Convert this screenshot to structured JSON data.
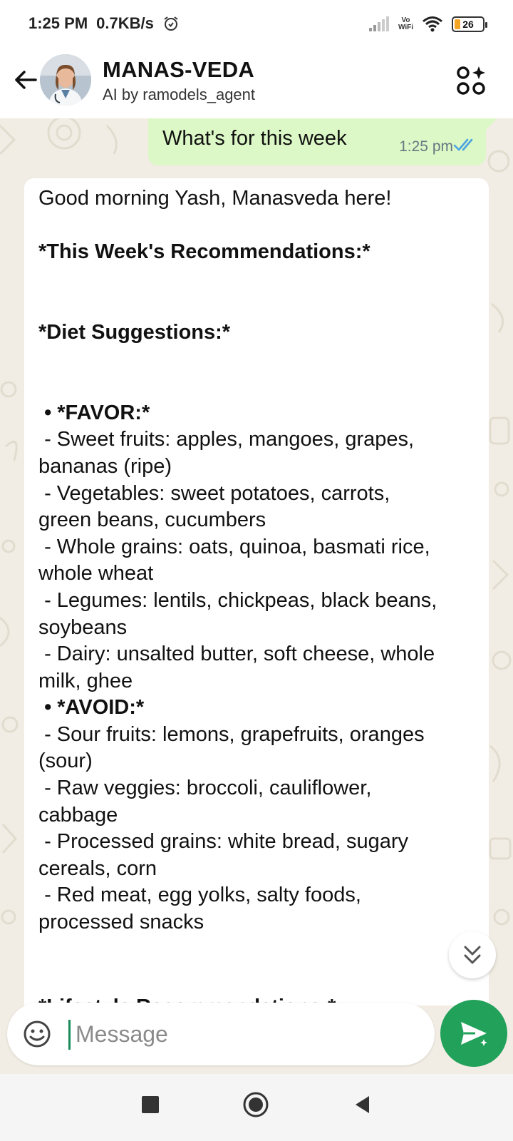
{
  "status_bar": {
    "time": "1:25 PM",
    "speed": "0.7KB/s",
    "vowifi_top": "Vo",
    "vowifi_bottom": "WiFi",
    "battery": "26"
  },
  "header": {
    "title": "MANAS-VEDA",
    "subtitle": "AI by ramodels_agent"
  },
  "messages": {
    "outgoing": {
      "text": "What's for this week",
      "time": "1:25 pm"
    },
    "incoming": {
      "lines": [
        {
          "text": "Good morning Yash, Manasveda here!",
          "bold": false
        },
        {
          "text": "",
          "bold": false
        },
        {
          "text": "*This Week's Recommendations:*",
          "bold": true
        },
        {
          "text": "",
          "bold": false
        },
        {
          "text": "",
          "bold": false
        },
        {
          "text": "*Diet Suggestions:*",
          "bold": true
        },
        {
          "text": "",
          "bold": false
        },
        {
          "text": "",
          "bold": false
        },
        {
          "text": " • *FAVOR:*",
          "bold": true
        },
        {
          "text": " - Sweet fruits: apples, mangoes, grapes,",
          "bold": false
        },
        {
          "text": "bananas (ripe)",
          "bold": false
        },
        {
          "text": " - Vegetables: sweet potatoes, carrots,",
          "bold": false
        },
        {
          "text": "green beans, cucumbers",
          "bold": false
        },
        {
          "text": " - Whole grains: oats, quinoa, basmati rice,",
          "bold": false
        },
        {
          "text": "whole wheat",
          "bold": false
        },
        {
          "text": " - Legumes: lentils, chickpeas, black beans,",
          "bold": false
        },
        {
          "text": "soybeans",
          "bold": false
        },
        {
          "text": " - Dairy: unsalted butter, soft cheese, whole",
          "bold": false
        },
        {
          "text": "milk, ghee",
          "bold": false
        },
        {
          "text": " • *AVOID:*",
          "bold": true
        },
        {
          "text": " - Sour fruits: lemons, grapefruits, oranges",
          "bold": false
        },
        {
          "text": "(sour)",
          "bold": false
        },
        {
          "text": " - Raw veggies: broccoli, cauliflower,",
          "bold": false
        },
        {
          "text": "cabbage",
          "bold": false
        },
        {
          "text": " - Processed grains: white bread, sugary",
          "bold": false
        },
        {
          "text": "cereals, corn",
          "bold": false
        },
        {
          "text": " - Red meat, egg yolks, salty foods,",
          "bold": false
        },
        {
          "text": "processed snacks",
          "bold": false
        }
      ],
      "cut_line": "*Lifestyle Recommendations:*"
    }
  },
  "composer": {
    "placeholder": "Message"
  },
  "colors": {
    "outgoing_bubble": "#dcf8c6",
    "send_button": "#21a15a",
    "read_ticks": "#4aa3e0",
    "chat_background": "#f2ede4"
  },
  "icons": [
    "back-arrow-icon",
    "apps-plus-icon",
    "double-check-icon",
    "chevron-double-down-icon",
    "emoji-icon",
    "send-sparkle-icon",
    "alarm-icon",
    "signal-icon",
    "wifi-icon"
  ]
}
